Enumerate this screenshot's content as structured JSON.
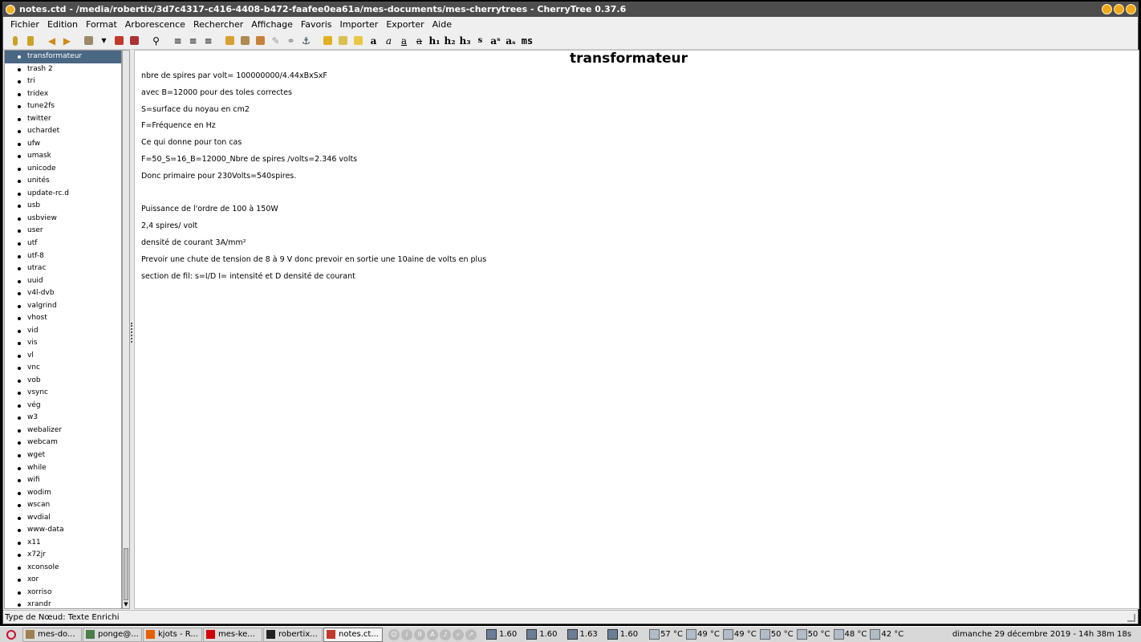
{
  "window": {
    "title": "notes.ctd - /media/robertix/3d7c4317-c416-4408-b472-faafee0ea61a/mes-documents/mes-cherrytrees - CherryTree 0.37.6"
  },
  "menu": [
    "Fichier",
    "Edition",
    "Format",
    "Arborescence",
    "Rechercher",
    "Affichage",
    "Favoris",
    "Importer",
    "Exporter",
    "Aide"
  ],
  "toolbar": {
    "format_labels": {
      "bold": "a",
      "italic": "a",
      "underline": "a",
      "strike": "a",
      "h1": "h₁",
      "h2": "h₂",
      "h3": "h₃",
      "small": "s",
      "superscript": "aˢ",
      "subscript": "aₛ",
      "monospace": "ms"
    },
    "icons": [
      "add-node-icon",
      "add-subnode-icon",
      "back-icon",
      "forward-icon",
      "open-icon",
      "dropdown-icon",
      "export-pdf-icon",
      "print-icon",
      "find-icon",
      "bullet-list-icon",
      "numbered-list-icon",
      "todo-list-icon",
      "insert-image-icon",
      "insert-table-icon",
      "insert-codebox-icon",
      "insert-file-icon",
      "insert-link-icon",
      "insert-anchor-icon",
      "text-color-icon",
      "highlight-icon",
      "clear-format-icon"
    ]
  },
  "tree": {
    "selected": "transformateur",
    "nodes": [
      "transformateur",
      "trash 2",
      "tri",
      "tridex",
      "tune2fs",
      "twitter",
      "uchardet",
      "ufw",
      "umask",
      "unicode",
      "unités",
      "update-rc.d",
      "usb",
      "usbview",
      "user",
      "utf",
      "utf-8",
      "utrac",
      "uuid",
      "v4l-dvb",
      "valgrind",
      "vhost",
      "vid",
      "vis",
      "vl",
      "vnc",
      "vob",
      "vsync",
      "vég",
      "w3",
      "webalizer",
      "webcam",
      "wget",
      "while",
      "wifi",
      "wodim",
      "wscan",
      "wvdial",
      "www-data",
      "x11",
      "x72jr",
      "xconsole",
      "xor",
      "xorriso",
      "xrandr"
    ]
  },
  "editor": {
    "node_title": "transformateur",
    "lines": [
      "nbre de spires par volt= 100000000/4.44xBxSxF",
      "avec B=12000 pour des toles correctes",
      "S=surface du noyau en cm2",
      "F=Fréquence en Hz",
      "Ce qui donne pour ton cas",
      "F=50_S=16_B=12000_Nbre de spires /volts=2.346 volts",
      "Donc primaire pour 230Volts=540spires.",
      "",
      "Puissance de l'ordre de 100 à 150W",
      "2,4 spires/ volt",
      "densité de courant 3A/mm²",
      "Prevoir une chute de tension de 8 à 9 V donc prevoir en sortie une 10aine de volts en plus",
      "section de fil: s=I/D I= intensité et D densité de courant"
    ]
  },
  "status": {
    "text": "Type de Nœud: Texte Enrichi"
  },
  "taskbar": {
    "tasks": [
      {
        "label": "mes-do...",
        "icon": "folder-icon",
        "color": "#a08050",
        "active": false
      },
      {
        "label": "ponge@...",
        "icon": "terminal-icon",
        "color": "#4b7e4b",
        "active": false
      },
      {
        "label": "kjots - R...",
        "icon": "firefox-icon",
        "color": "#e66000",
        "active": false
      },
      {
        "label": "mes-ke...",
        "icon": "app-red-icon",
        "color": "#d40000",
        "active": false
      },
      {
        "label": "robertix...",
        "icon": "terminal-icon",
        "color": "#222222",
        "active": false
      },
      {
        "label": "notes.ct...",
        "icon": "cherrytree-icon",
        "color": "#c0392b",
        "active": true
      }
    ],
    "tray_glyphs": [
      "☺",
      "i",
      "9",
      "A",
      "♪",
      "⌕",
      "↗"
    ],
    "cpu": [
      "1.60",
      "1.60",
      "1.63",
      "1.60"
    ],
    "temps": [
      "57 °C",
      "49 °C",
      "49 °C",
      "50 °C",
      "50 °C",
      "48 °C",
      "42 °C"
    ],
    "clock": "dimanche 29 décembre 2019 - 14h 38m 18s"
  }
}
